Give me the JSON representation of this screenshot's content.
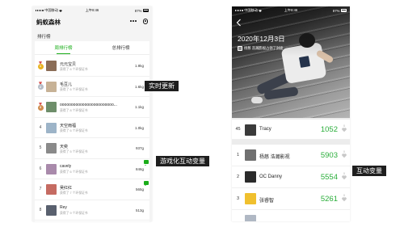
{
  "left_phone": {
    "status_bar": {
      "carrier": "中国移动",
      "time": "上午8:46",
      "battery": "87%"
    },
    "title": "蚂蚁森林",
    "section_title": "排行榜",
    "tabs": [
      {
        "label": "周排行榜",
        "active": true
      },
      {
        "label": "总排行榜",
        "active": false
      }
    ],
    "rows": [
      {
        "rank": "1",
        "medal_color": "#e9b322",
        "name": "元元宝贝",
        "subtitle": "获得了 6 个环保证书",
        "value": "1.9kg",
        "avatar_color": "#8b6d57"
      },
      {
        "rank": "2",
        "medal_color": "#b5bcc6",
        "name": "毛豆儿",
        "subtitle": "获得了 6 个环保证书",
        "value": "1.6kg",
        "avatar_color": "#c7b296"
      },
      {
        "rank": "3",
        "medal_color": "#cf8d4e",
        "name": "oooooooooooooooooooooooo...",
        "subtitle": "获得了 8 个环保证书",
        "value": "1.1kg",
        "avatar_color": "#6e8e6a"
      },
      {
        "rank": "4",
        "name": "天空雨福",
        "subtitle": "获得了 6 个环保证书",
        "value": "1.0kg",
        "avatar_color": "#9db4c8"
      },
      {
        "rank": "5",
        "name": "天奕",
        "subtitle": "获得了 5 个环保证书",
        "value": "937g",
        "avatar_color": "#8a8a8a"
      },
      {
        "rank": "6",
        "name": "cavely",
        "subtitle": "获得了 6 个环保证书",
        "value": "846g",
        "avatar_color": "#a98aab"
      },
      {
        "rank": "7",
        "name": "吴红红",
        "subtitle": "获得了 7 个环保证书",
        "value": "565g",
        "avatar_color": "#c56b62"
      },
      {
        "rank": "8",
        "name": "Rey",
        "subtitle": "获得了 9 个环保证书",
        "value": "513g",
        "avatar_color": "#59606e"
      }
    ]
  },
  "annotations": {
    "realtime_update": "实时更新",
    "gamified_interaction": "游戏化互动变量",
    "interaction_variable": "互动变量"
  },
  "right_phone": {
    "status_bar": {
      "carrier": "中国移动",
      "time": "上午8:46",
      "battery": "87%"
    },
    "date": "2020年12月3日",
    "cover_caption": "杨慈 浩瀚影视占领了封面",
    "my_rank": {
      "rank": "45",
      "name": "Tracy",
      "steps": "1052",
      "likes": "0",
      "avatar_color": "#3b3b3b"
    },
    "rows": [
      {
        "rank": "1",
        "name": "杨慈 浩瀚影视",
        "steps": "5903",
        "likes": "0",
        "avatar_color": "#707070"
      },
      {
        "rank": "2",
        "name": "OC Danny",
        "steps": "5554",
        "likes": "0",
        "avatar_color": "#2b2b2b"
      },
      {
        "rank": "3",
        "name": "张睿智",
        "steps": "5261",
        "likes": "0",
        "avatar_color": "#f0c02e"
      }
    ]
  },
  "icons": {
    "more": "more-icon",
    "close": "close-circle-icon",
    "back": "back-arrow-icon",
    "like": "heart-icon",
    "message": "message-bubble-icon"
  },
  "colors": {
    "accent": "#1aad19",
    "steps_green": "#2aae3a",
    "annotation_bg": "#1e1e1e"
  }
}
